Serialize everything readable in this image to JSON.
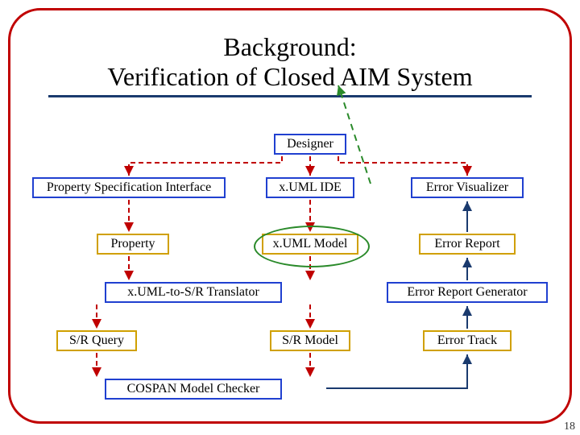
{
  "title_l1": "Background:",
  "title_l2": "Verification of Closed AIM System",
  "nodes": {
    "designer": "Designer",
    "psi": "Property Specification Interface",
    "xumlide": "x.UML IDE",
    "errvis": "Error Visualizer",
    "property": "Property",
    "xumlmodel": "x.UML Model",
    "errreport": "Error Report",
    "translator": "x.UML-to-S/R Translator",
    "errgen": "Error Report Generator",
    "srquery": "S/R Query",
    "srmodel": "S/R Model",
    "errtrack": "Error Track",
    "cospan": "COSPAN Model Checker"
  },
  "page": "18"
}
